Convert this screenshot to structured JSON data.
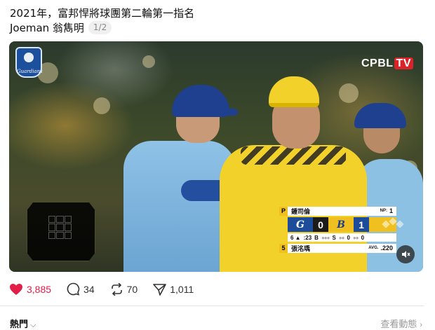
{
  "post": {
    "text_line1": "2021年，富邦悍將球團第二輪第一指名",
    "text_line2": "Joeman 翁雋明",
    "page_counter": "1/2"
  },
  "media": {
    "broadcaster": "CPBL",
    "broadcaster_suffix": "TV",
    "team_logo_text": "Guardians",
    "scoreboard": {
      "pitcher_tag": "P",
      "pitcher_name": "鍾司倫",
      "pitcher_stat_label": "NP:",
      "pitcher_stat_value": "1",
      "away_abbr": "G",
      "away_runs": "0",
      "home_abbr": "B",
      "home_runs": "1",
      "inning": "6 ▲",
      "clock": ":23",
      "balls_label": "B",
      "strikes_label": "S",
      "strikes_value": "0",
      "outs_value": "0",
      "batter_tag": "5",
      "batter_name": "張洺瑀",
      "batter_stat_label": "AVG.",
      "batter_stat_value": ".220"
    }
  },
  "actions": {
    "likes": "3,885",
    "comments": "34",
    "reposts": "70",
    "shares": "1,011",
    "like_color": "#e11d48"
  },
  "footer": {
    "left_label": "熱門",
    "right_label": "查看動態"
  }
}
